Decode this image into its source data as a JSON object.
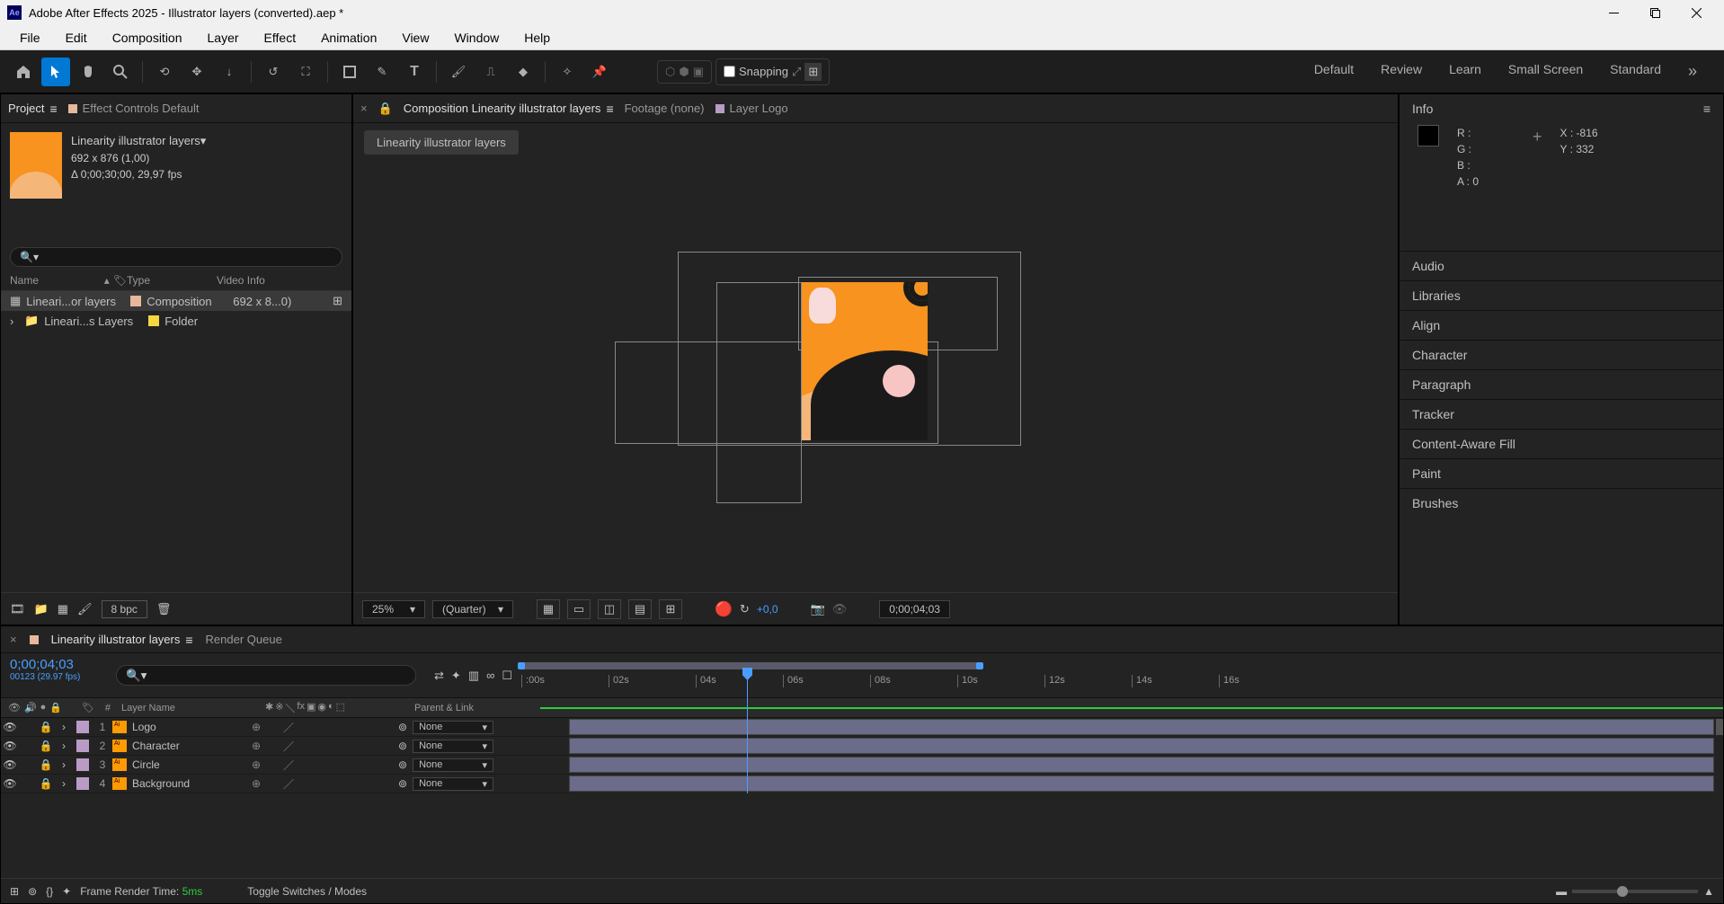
{
  "titlebar": {
    "app_icon_text": "Ae",
    "title": "Adobe After Effects 2025 - Illustrator layers (converted).aep *"
  },
  "menubar": [
    "File",
    "Edit",
    "Composition",
    "Layer",
    "Effect",
    "Animation",
    "View",
    "Window",
    "Help"
  ],
  "toolbar": {
    "snapping_label": "Snapping"
  },
  "workspaces": [
    "Default",
    "Review",
    "Learn",
    "Small Screen",
    "Standard"
  ],
  "project_panel": {
    "tab_project": "Project",
    "tab_effect_controls": "Effect Controls Default",
    "selected_name": "Linearity illustrator layers▾",
    "dimensions": "692 x 876 (1,00)",
    "duration_fps": "Δ 0;00;30;00, 29,97 fps",
    "search_placeholder": "",
    "cols": {
      "name": "Name",
      "type": "Type",
      "info": "Video Info"
    },
    "items": [
      {
        "name": "Lineari...or layers",
        "type": "Composition",
        "info": "692 x 8...0)",
        "chip": "#e6b89c",
        "selected": true,
        "icon": "comp"
      },
      {
        "name": "Lineari...s Layers",
        "type": "Folder",
        "info": "",
        "chip": "#f5d742",
        "selected": false,
        "icon": "folder"
      }
    ],
    "bpc_label": "8 bpc"
  },
  "comp_panel": {
    "tab_close": "×",
    "tab_lock": "🔒",
    "tab_label": "Composition Linearity illustrator layers",
    "tab_footage": "Footage (none)",
    "tab_layer": "Layer Logo",
    "breadcrumb": "Linearity illustrator layers",
    "zoom": "25%",
    "resolution": "(Quarter)",
    "exposure": "+0,0",
    "timecode": "0;00;04;03",
    "layer_chip": "#b89cc5"
  },
  "info_panel": {
    "title": "Info",
    "r": "R :",
    "g": "G :",
    "b": "B :",
    "a": "A :  0",
    "x": "X :  -816",
    "y": "Y :  332"
  },
  "right_panels": [
    "Audio",
    "Libraries",
    "Align",
    "Character",
    "Paragraph",
    "Tracker",
    "Content-Aware Fill",
    "Paint",
    "Brushes"
  ],
  "timeline": {
    "tab_close": "×",
    "tab_label": "Linearity illustrator layers",
    "tab_render_queue": "Render Queue",
    "tab_chip": "#e6b89c",
    "current_time": "0;00;04;03",
    "frames_fps": "00123 (29.97 fps)",
    "ruler_marks": [
      ":00s",
      "02s",
      "04s",
      "06s",
      "08s",
      "10s",
      "12s",
      "14s",
      "16s"
    ],
    "header": {
      "hash": "#",
      "layer_name": "Layer Name",
      "parent_link": "Parent & Link"
    },
    "layers": [
      {
        "num": "1",
        "name": "Logo",
        "chip": "#b89cc5",
        "parent": "None"
      },
      {
        "num": "2",
        "name": "Character",
        "chip": "#b89cc5",
        "parent": "None"
      },
      {
        "num": "3",
        "name": "Circle",
        "chip": "#b89cc5",
        "parent": "None"
      },
      {
        "num": "4",
        "name": "Background",
        "chip": "#b89cc5",
        "parent": "None"
      }
    ],
    "frame_render_label": "Frame Render Time:",
    "frame_render_value": "5ms",
    "toggle_label": "Toggle Switches / Modes"
  }
}
